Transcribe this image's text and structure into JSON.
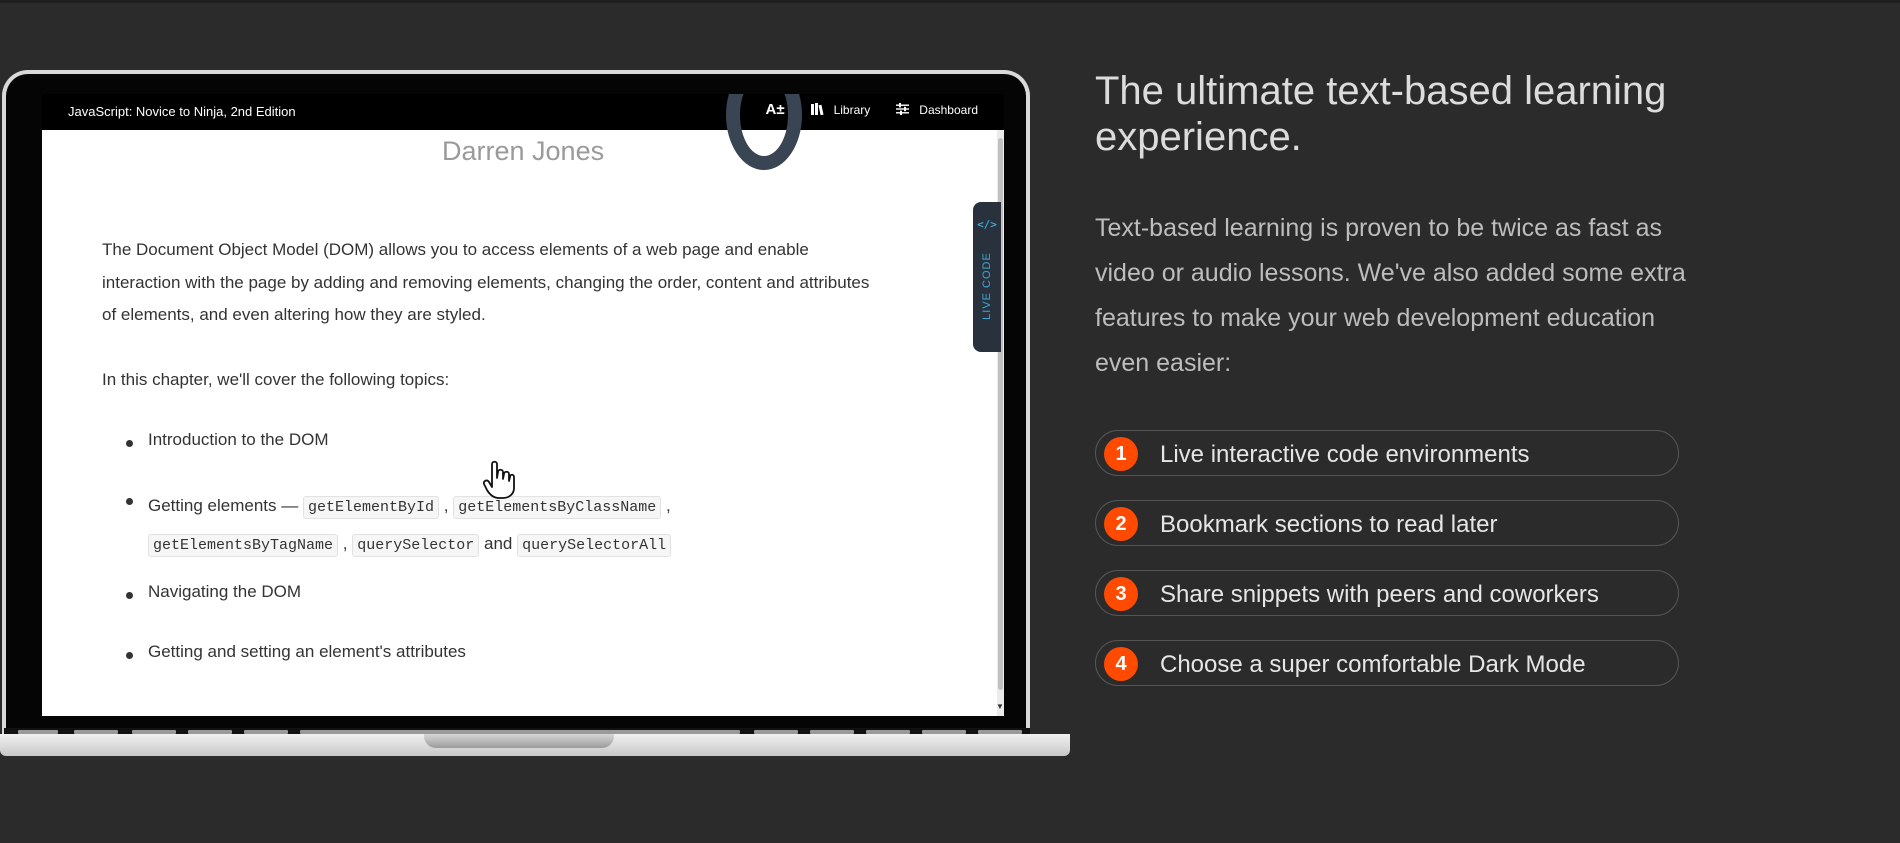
{
  "app_bar": {
    "title": "JavaScript: Novice to Ninja, 2nd Edition",
    "tools": [
      {
        "icon": "contrast-icon",
        "label": ""
      },
      {
        "icon": "font-size-icon",
        "label": ""
      },
      {
        "icon": "library-icon",
        "label": "Library"
      },
      {
        "icon": "sliders-icon",
        "label": "Dashboard"
      }
    ]
  },
  "content": {
    "author": "Darren Jones",
    "intro": "The Document Object Model (DOM) allows you to access elements of a web page and enable interaction with the page by adding and removing elements, changing the order, content and attributes of elements, and even altering how they are styled.",
    "topics_lead": "In this chapter, we'll cover the following topics:",
    "topics": {
      "introduction": "Introduction to the DOM",
      "getting_elements": {
        "prefix": "Getting elements —",
        "comma": ",",
        "and": "and",
        "codes": [
          "getElementById",
          "getElementsByClassName",
          "getElementsByTagName",
          "querySelector",
          "querySelectorAll"
        ]
      },
      "navigating": "Navigating the DOM",
      "attributes": "Getting and setting an element's attributes"
    }
  },
  "live_code": {
    "icon": "</>",
    "label": "LIVE CODE"
  },
  "marketing": {
    "heading": "The ultimate text-based learning experience.",
    "description": "Text-based learning is proven to be twice as fast as video or audio lessons. We've also added some extra features to make your web development education even easier:",
    "features": [
      {
        "number": "1",
        "text": "Live interactive code environments"
      },
      {
        "number": "2",
        "text": "Bookmark sections to read later"
      },
      {
        "number": "3",
        "text": "Share snippets with peers and coworkers"
      },
      {
        "number": "4",
        "text": "Choose a super comfortable Dark Mode"
      }
    ]
  },
  "colors": {
    "page_background": "#2b2b2b",
    "accent": "#ff4a00",
    "live_code_accent": "#39a8d8"
  }
}
